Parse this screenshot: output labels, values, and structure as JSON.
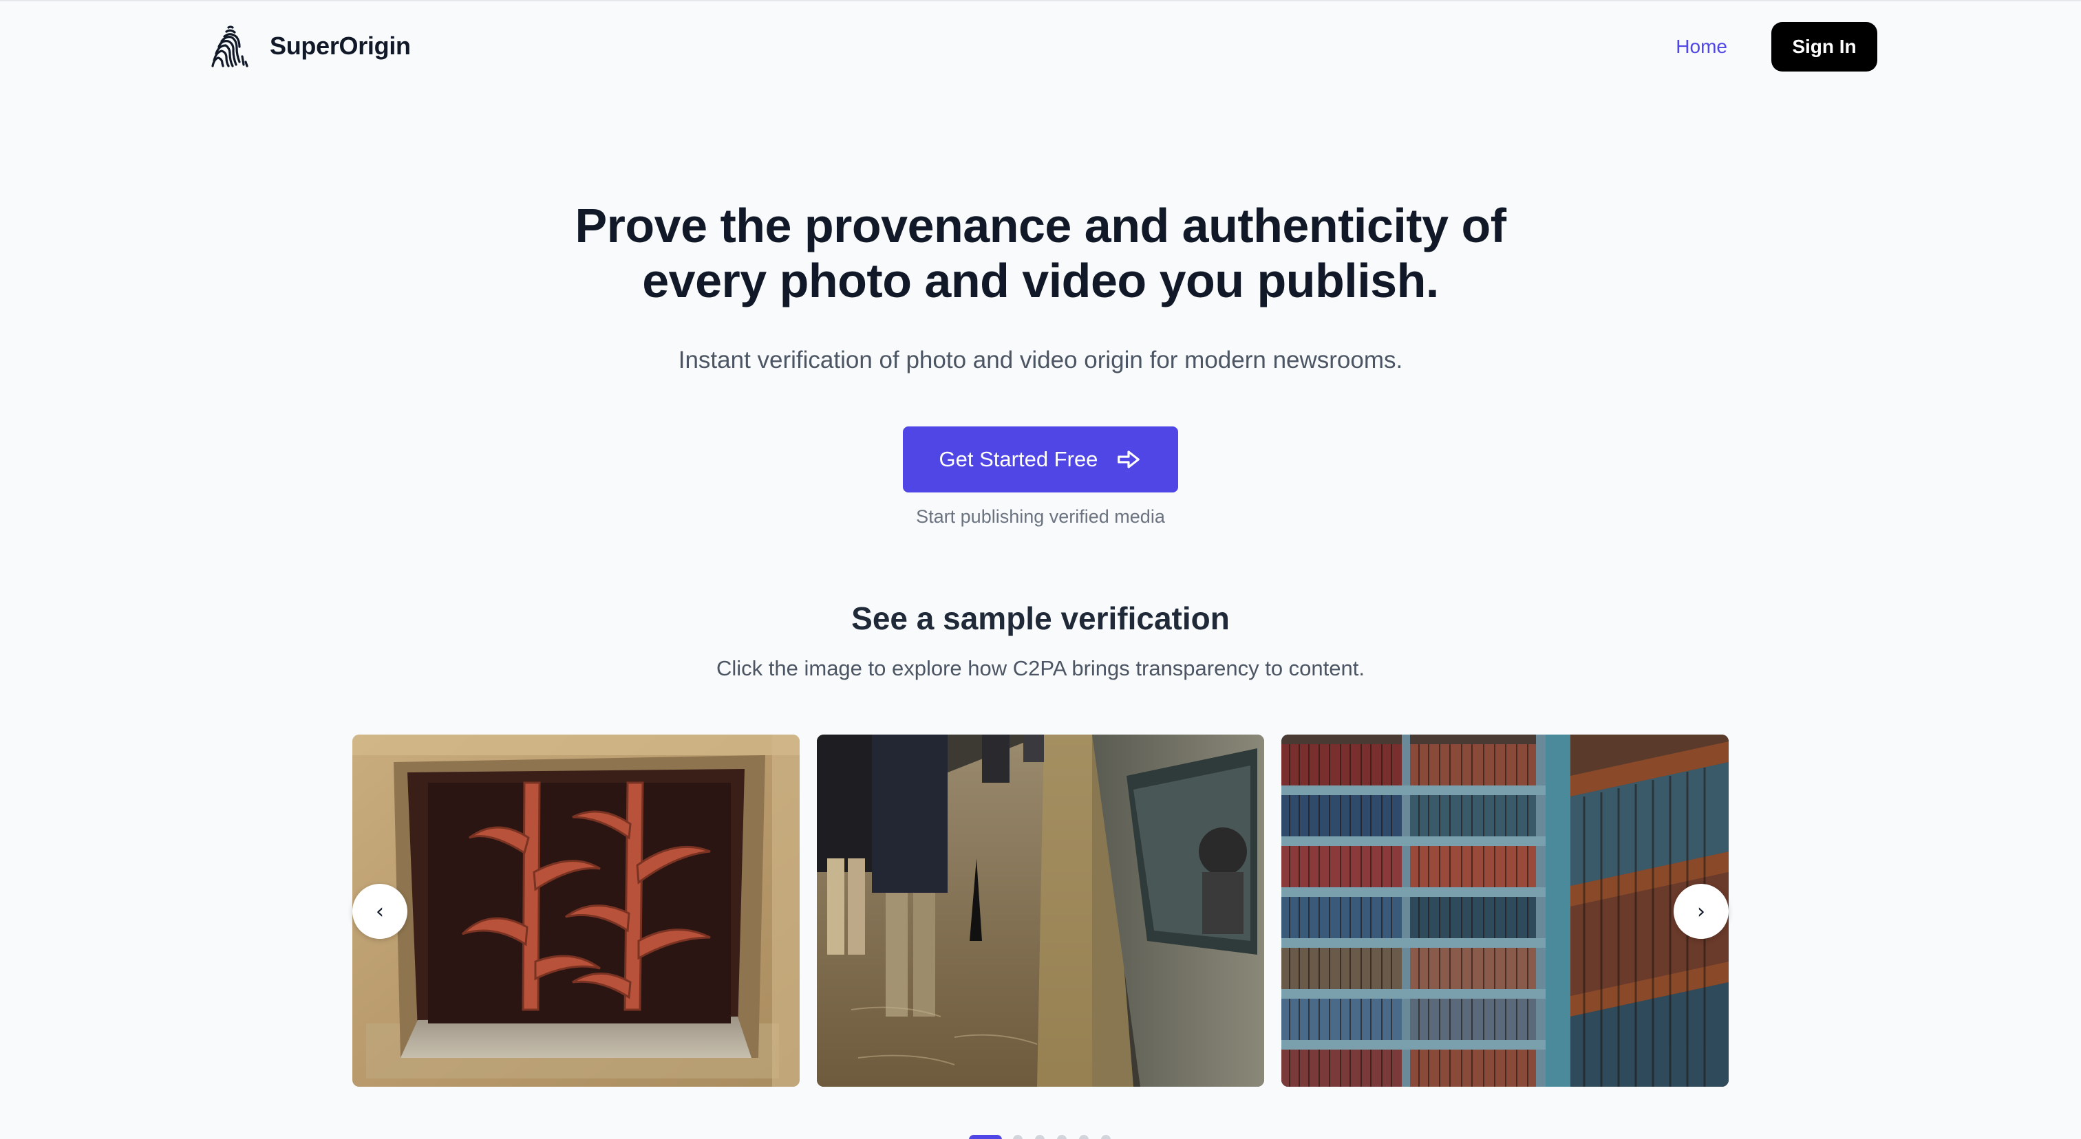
{
  "brand": {
    "name": "SuperOrigin",
    "logo_icon": "fingerprint-icon"
  },
  "nav": {
    "home_label": "Home",
    "signin_label": "Sign In"
  },
  "hero": {
    "title_line1": "Prove the provenance and authenticity of",
    "title_line2": "every photo and video you publish.",
    "subtitle": "Instant verification of photo and video origin for modern newsrooms.",
    "cta_label": "Get Started Free",
    "cta_icon": "arrow-right-icon",
    "cta_note": "Start publishing verified media"
  },
  "sample": {
    "title": "See a sample verification",
    "subtitle": "Click the image to explore how C2PA brings transparency to content.",
    "prev_label": "‹",
    "next_label": "›",
    "slides": [
      {
        "subject": "rusted-iron-window-grate"
      },
      {
        "subject": "flooded-subway-platform"
      },
      {
        "subject": "library-bookshelves"
      }
    ],
    "dots_total": 6,
    "active_dot": 0
  },
  "colors": {
    "accent": "#4f46e5",
    "background": "#f9fafb",
    "text_primary": "#111827",
    "text_secondary": "#4b5563",
    "signin_bg": "#000000"
  }
}
